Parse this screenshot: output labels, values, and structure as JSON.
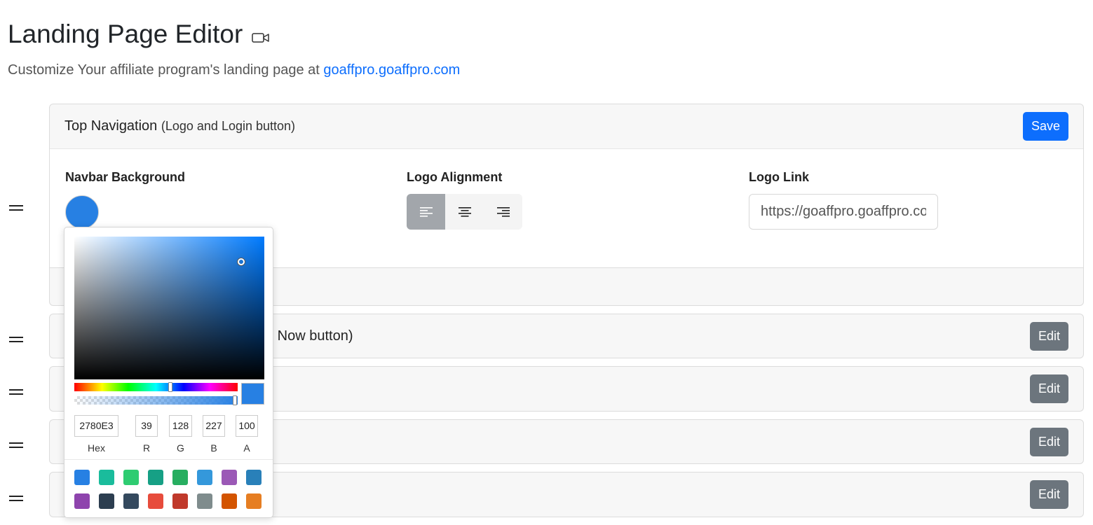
{
  "header": {
    "title": "Landing Page Editor",
    "subtitle_prefix": "Customize Your affiliate program's landing page at ",
    "subtitle_link": "goaffpro.goaffpro.com",
    "video_icon": "video-camera-icon"
  },
  "top_nav_card": {
    "title": "Top Navigation",
    "subtitle": "(Logo and Login button)",
    "save_label": "Save",
    "navbar_bg_label": "Navbar Background",
    "navbar_bg_color": "#2780E3",
    "logo_alignment_label": "Logo Alignment",
    "alignment_options": [
      "align-left-icon",
      "align-center-icon",
      "align-right-icon"
    ],
    "alignment_selected": "left",
    "logo_link_label": "Logo Link",
    "logo_link_value": "https://goaffpro.goaffpro.com"
  },
  "sections": [
    {
      "title_visible": "n Now button)",
      "edit_label": "Edit"
    },
    {
      "title_visible": "",
      "edit_label": "Edit"
    },
    {
      "title_visible": "",
      "edit_label": "Edit"
    },
    {
      "title_visible": "",
      "edit_label": "Edit"
    }
  ],
  "color_picker": {
    "hex": "2780E3",
    "r": "39",
    "g": "128",
    "b": "227",
    "a": "100",
    "labels": {
      "hex": "Hex",
      "r": "R",
      "g": "G",
      "b": "B",
      "a": "A"
    },
    "presets": [
      "#2780E3",
      "#1ABC9C",
      "#2ECC71",
      "#16A085",
      "#27AE60",
      "#3498DB",
      "#9B59B6",
      "#2980B9",
      "#8E44AD",
      "#2C3E50",
      "#34495E",
      "#E74C3C",
      "#C0392B",
      "#7F8C8D",
      "#D35400",
      "#E67E22"
    ]
  }
}
